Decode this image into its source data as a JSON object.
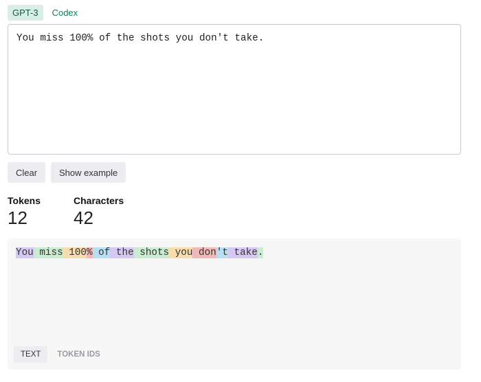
{
  "tabs": [
    {
      "label": "GPT-3",
      "active": true
    },
    {
      "label": "Codex",
      "active": false
    }
  ],
  "input": {
    "value": "You miss 100% of the shots you don't take."
  },
  "buttons": {
    "clear": "Clear",
    "show_example": "Show example"
  },
  "stats": {
    "tokens_label": "Tokens",
    "tokens_value": "12",
    "characters_label": "Characters",
    "characters_value": "42"
  },
  "token_colors": [
    "#d5c9f2",
    "#c9ecd0",
    "#f7dcae",
    "#f2b8b8",
    "#b9dff3"
  ],
  "tokens": [
    "You",
    " miss",
    " 100",
    "%",
    " of",
    " the",
    " shots",
    " you",
    " don",
    "'t",
    " take",
    "."
  ],
  "view_tabs": [
    {
      "label": "TEXT",
      "active": true
    },
    {
      "label": "TOKEN IDS",
      "active": false
    }
  ]
}
